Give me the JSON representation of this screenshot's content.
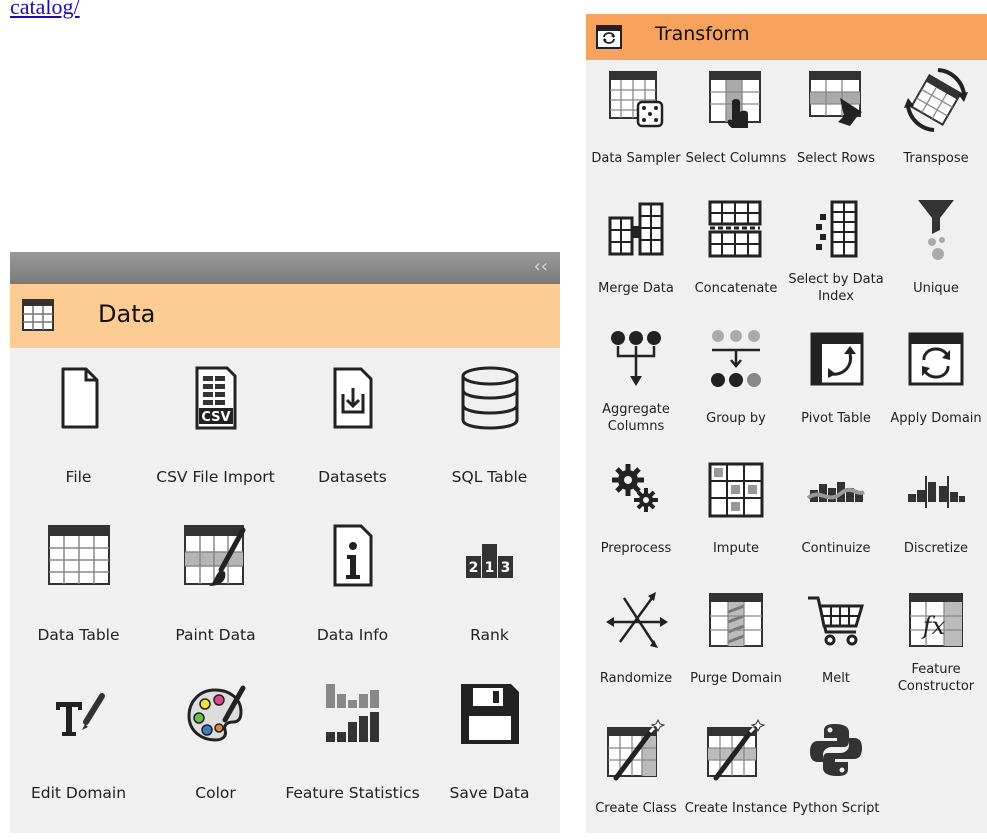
{
  "link": {
    "text": "catalog/"
  },
  "data_panel": {
    "collapse_glyph": "‹‹",
    "title": "Data",
    "widgets": [
      {
        "label": "File",
        "icon": "file-icon"
      },
      {
        "label": "CSV File Import",
        "icon": "csv-icon"
      },
      {
        "label": "Datasets",
        "icon": "datasets-icon"
      },
      {
        "label": "SQL Table",
        "icon": "database-icon"
      },
      {
        "label": "Data Table",
        "icon": "table-icon"
      },
      {
        "label": "Paint Data",
        "icon": "paint-brush-icon"
      },
      {
        "label": "Data Info",
        "icon": "info-icon"
      },
      {
        "label": "Rank",
        "icon": "rank-podium-icon"
      },
      {
        "label": "Edit Domain",
        "icon": "text-edit-icon"
      },
      {
        "label": "Color",
        "icon": "palette-icon"
      },
      {
        "label": "Feature Statistics",
        "icon": "bar-stats-icon"
      },
      {
        "label": "Save Data",
        "icon": "floppy-disk-icon"
      }
    ]
  },
  "transform_panel": {
    "title": "Transform",
    "widgets": [
      {
        "label": "Data Sampler",
        "icon": "dice-table-icon"
      },
      {
        "label": "Select Columns",
        "icon": "select-columns-icon"
      },
      {
        "label": "Select Rows",
        "icon": "select-rows-icon"
      },
      {
        "label": "Transpose",
        "icon": "transpose-icon"
      },
      {
        "label": "Merge Data",
        "icon": "merge-icon"
      },
      {
        "label": "Concatenate",
        "icon": "concatenate-icon"
      },
      {
        "label": "Select by Data Index",
        "icon": "select-index-icon"
      },
      {
        "label": "Unique",
        "icon": "funnel-icon"
      },
      {
        "label": "Aggregate Columns",
        "icon": "aggregate-icon"
      },
      {
        "label": "Group by",
        "icon": "group-by-icon"
      },
      {
        "label": "Pivot Table",
        "icon": "pivot-icon"
      },
      {
        "label": "Apply Domain",
        "icon": "apply-domain-icon"
      },
      {
        "label": "Preprocess",
        "icon": "gears-icon"
      },
      {
        "label": "Impute",
        "icon": "impute-icon"
      },
      {
        "label": "Continuize",
        "icon": "continuize-icon"
      },
      {
        "label": "Discretize",
        "icon": "discretize-icon"
      },
      {
        "label": "Randomize",
        "icon": "randomize-arrows-icon"
      },
      {
        "label": "Purge Domain",
        "icon": "purge-icon"
      },
      {
        "label": "Melt",
        "icon": "cart-icon"
      },
      {
        "label": "Feature Constructor",
        "icon": "fx-table-icon"
      },
      {
        "label": "Create Class",
        "icon": "wand-table-icon"
      },
      {
        "label": "Create Instance",
        "icon": "wand-instance-icon"
      },
      {
        "label": "Python Script",
        "icon": "python-icon"
      }
    ]
  }
}
